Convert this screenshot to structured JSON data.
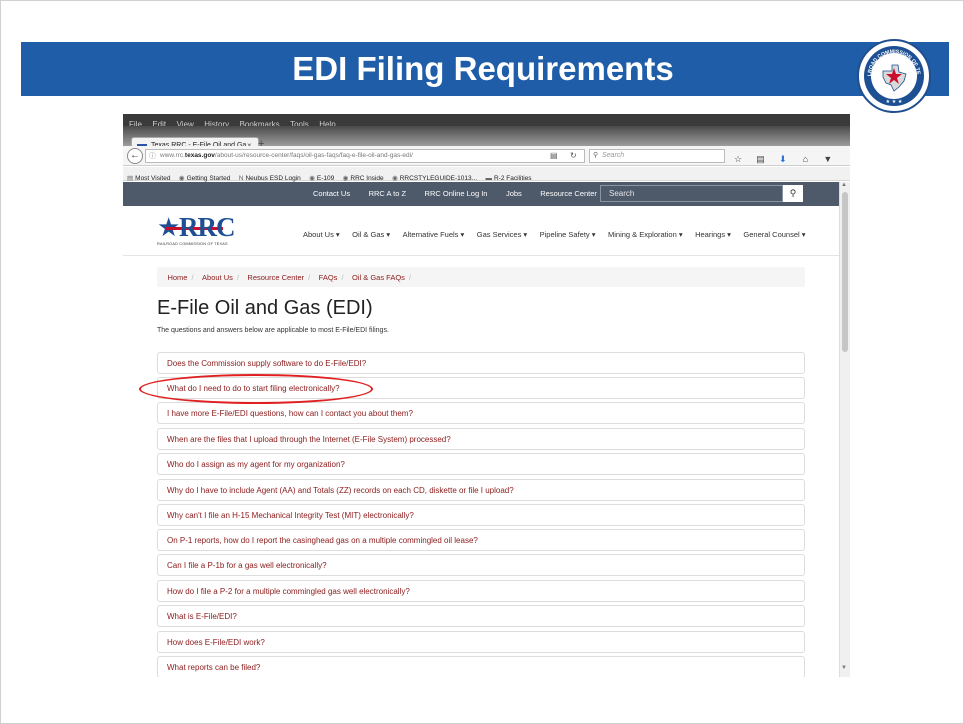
{
  "slide": {
    "title": "EDI Filing Requirements",
    "seal": {
      "text_top": "RAILROAD COMMISSION OF TEXAS",
      "stars": "★ ★ ★",
      "colors": {
        "ring": "#1d4f93",
        "star": "#c8102e"
      }
    },
    "banner_color": "#1f5da8"
  },
  "browser": {
    "menu": [
      "File",
      "Edit",
      "View",
      "History",
      "Bookmarks",
      "Tools",
      "Help"
    ],
    "tab": {
      "label": "Texas RRC - E-File Oil and Ga",
      "close": "×"
    },
    "new_tab": "+",
    "url": {
      "prefix": "www.rrc.",
      "domain": "texas.gov",
      "path": "/about-us/resource-center/faqs/oil-gas-faqs/faq-e-file-oil-and-gas-edi/"
    },
    "search_placeholder": "Search",
    "bookmarks": [
      {
        "icon": "▤",
        "label": "Most Visited"
      },
      {
        "icon": "◉",
        "label": "Getting Started"
      },
      {
        "icon": "N",
        "label": "Neubus ESD Login"
      },
      {
        "icon": "◉",
        "label": "E-109"
      },
      {
        "icon": "◉",
        "label": "RRC Inside"
      },
      {
        "icon": "◉",
        "label": "RRCSTYLEGUIDE-1013..."
      },
      {
        "icon": "▬",
        "label": "R-2 Facilities"
      }
    ]
  },
  "site": {
    "top_links": [
      "Contact Us",
      "RRC A to Z",
      "RRC Online Log In",
      "Jobs",
      "Resource Center"
    ],
    "search_placeholder": "Search",
    "logo": {
      "mark": "RRC",
      "sub": "RAILROAD COMMISSION OF TEXAS"
    },
    "nav": [
      "About Us ▾",
      "Oil & Gas ▾",
      "Alternative Fuels ▾",
      "Gas Services ▾",
      "Pipeline Safety ▾",
      "Mining & Exploration ▾",
      "Hearings ▾",
      "General Counsel ▾"
    ],
    "breadcrumb": [
      "Home",
      "About Us",
      "Resource Center",
      "FAQs",
      "Oil & Gas FAQs"
    ],
    "heading": "E-File Oil and Gas (EDI)",
    "intro": "The questions and answers below are applicable to most E-File/EDI filings.",
    "faqs": [
      "Does the Commission supply software to do E-File/EDI?",
      "What do I need to do to start filing electronically?",
      "I have more E-File/EDI questions, how can I contact you about them?",
      "When are the files that I upload through the Internet (E-File System) processed?",
      "Who do I assign as my agent for my organization?",
      "Why do I have to include Agent (AA) and Totals (ZZ) records on each CD, diskette or file I upload?",
      "Why can't I file an H-15 Mechanical Integrity Test (MIT) electronically?",
      "On P-1 reports, how do I report the casinghead gas on a multiple commingled oil lease?",
      "Can I file a P-1b for a gas well electronically?",
      "How do I file a P-2 for a multiple commingled gas well electronically?",
      "What is E-File/EDI?",
      "How does E-File/EDI work?",
      "What reports can be filed?"
    ],
    "highlighted_faq_index": 1,
    "link_color": "#8b1a1a"
  }
}
